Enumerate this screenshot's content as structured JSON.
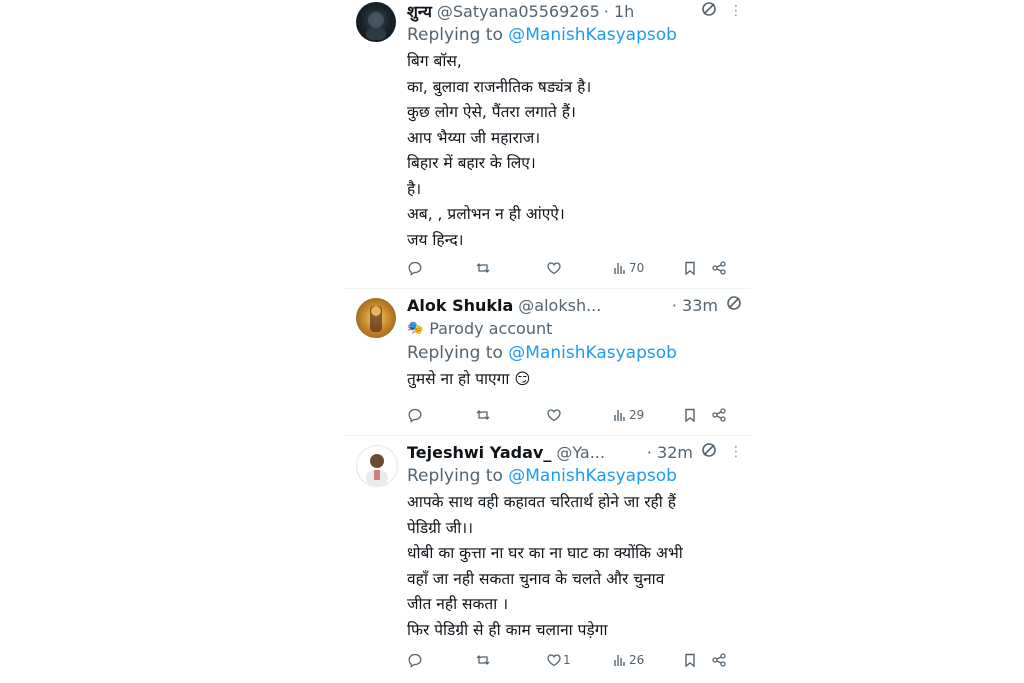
{
  "tweets": [
    {
      "name": "शुन्य",
      "handle": "@Satyana05569265",
      "time": "· 1h",
      "replying_prefix": "Replying to ",
      "replying_to": "@ManishKasyapsob",
      "lines": [
        "बिग बॉस,",
        "का, बुलावा राजनीतिक षड्यंत्र है।",
        "कुछ लोग ऐसे, पैंतरा लगाते हैं।",
        "आप भैय्या जी महाराज।",
        "बिहार में बहार के लिए।",
        "है।",
        "अब,  , प्रलोभन न ही आंएऐ।",
        "जय हिन्द।"
      ],
      "likes": "",
      "views": "70"
    },
    {
      "name": "Alok Shukla",
      "handle": "@aloksh...",
      "time": "· 33m",
      "parody_label": "Parody account",
      "replying_prefix": "Replying to ",
      "replying_to": "@ManishKasyapsob",
      "lines": [
        "तुमसे ना हो पाएगा 😏"
      ],
      "likes": "",
      "views": "29"
    },
    {
      "name": "Tejeshwi Yadav_",
      "handle": "@Ya...",
      "time": "· 32m",
      "replying_prefix": "Replying to ",
      "replying_to": "@ManishKasyapsob",
      "lines": [
        "आपके साथ वही कहावत चरितार्थ होने जा रही हैं",
        "पेडिग्री जी।।",
        "धोबी का कुत्ता ना घर का ना घाट का क्योंकि अभी",
        "वहाँ जा नही सकता चुनाव के चलते और चुनाव",
        "जीत नही सकता ।",
        "फिर पेडिग्री से ही काम चलाना पड़ेगा"
      ],
      "likes": "1",
      "views": "26"
    }
  ],
  "icons": {
    "reply": "reply-icon",
    "retweet": "retweet-icon",
    "like": "heart-icon",
    "views": "views-icon",
    "bookmark": "bookmark-icon",
    "share": "share-icon",
    "grok": "grok-icon",
    "more": "more-icon",
    "parody": "parody-mask-icon"
  },
  "colors": {
    "link": "#1d9bf0",
    "secondary": "#536471",
    "text": "#0f1419",
    "divider": "#eff3f4"
  }
}
